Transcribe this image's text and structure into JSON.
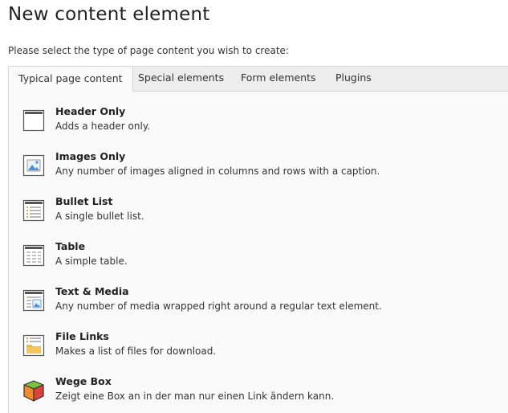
{
  "page": {
    "title": "New content element",
    "intro": "Please select the type of page content you wish to create:"
  },
  "tabs": [
    {
      "label": "Typical page content",
      "active": true
    },
    {
      "label": "Special elements",
      "active": false
    },
    {
      "label": "Form elements",
      "active": false
    },
    {
      "label": "Plugins",
      "active": false
    }
  ],
  "elements": [
    {
      "title": "Header Only",
      "description": "Adds a header only.",
      "icon": "header-icon"
    },
    {
      "title": "Images Only",
      "description": "Any number of images aligned in columns and rows with a caption.",
      "icon": "image-icon"
    },
    {
      "title": "Bullet List",
      "description": "A single bullet list.",
      "icon": "bullet-list-icon"
    },
    {
      "title": "Table",
      "description": "A simple table.",
      "icon": "table-icon"
    },
    {
      "title": "Text & Media",
      "description": "Any number of media wrapped right around a regular text element.",
      "icon": "text-media-icon"
    },
    {
      "title": "File Links",
      "description": "Makes a list of files for download.",
      "icon": "file-links-icon"
    },
    {
      "title": "Wege Box",
      "description": "Zeigt eine Box an in der man nur einen Link ändern kann.",
      "icon": "cube-icon"
    }
  ],
  "colors": {
    "icon_frame": "#555555",
    "image_accent": "#4a90d9",
    "bullet_accent": "#e8a33c",
    "folder": "#f0b545",
    "cube_green": "#7cc142",
    "cube_orange": "#f08a2c",
    "cube_red": "#d9433a"
  }
}
